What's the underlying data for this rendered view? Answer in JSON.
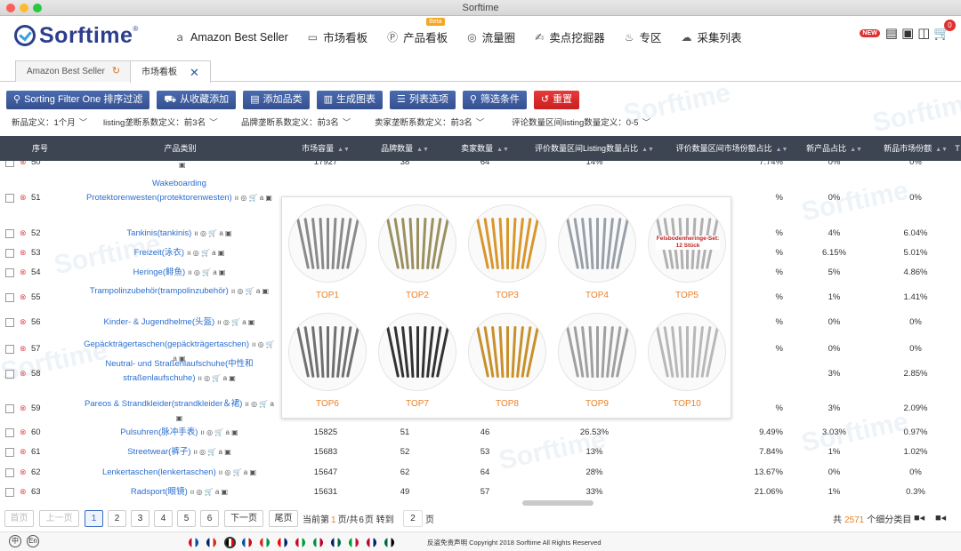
{
  "window": {
    "title": "Sorftime"
  },
  "brand": {
    "name": "Sorftime",
    "registered": "®"
  },
  "nav": [
    {
      "icon": "amazon-icon",
      "label": "Amazon Best Seller"
    },
    {
      "icon": "market-board-icon",
      "label": "市场看板"
    },
    {
      "icon": "product-board-icon",
      "label": "产品看板",
      "badge": "Beta"
    },
    {
      "icon": "traffic-circle-icon",
      "label": "流量圈"
    },
    {
      "icon": "selling-point-icon",
      "label": "卖点挖掘器"
    },
    {
      "icon": "lightbulb-icon",
      "label": "专区"
    },
    {
      "icon": "cloud-icon",
      "label": "采集列表"
    }
  ],
  "header_right": {
    "new_badge": "NEW",
    "cart_count": "0"
  },
  "tabs": [
    {
      "label": "Amazon Best Seller",
      "active": false
    },
    {
      "label": "市场看板",
      "active": true
    }
  ],
  "toolbar": {
    "sorting": "Sorting Filter One 排序过滤",
    "favorite": "从收藏添加",
    "add_category": "添加品类",
    "chart": "生成图表",
    "list_options": "列表选项",
    "filter": "筛选条件",
    "reset": "重置"
  },
  "filters": [
    "新品定义：1个月",
    "listing垄断系数定义：前3名",
    "品牌垄断系数定义：前3名",
    "卖家垄断系数定义：前3名",
    "评论数量区间listing数量定义：0-5"
  ],
  "columns": [
    "序号",
    "产品类别",
    "市场容量",
    "品牌数量",
    "卖家数量",
    "评价数量区间Listing数量占比",
    "评价数量区间市场份额占比",
    "新产品占比",
    "新品市场份额",
    "T"
  ],
  "rows": [
    {
      "id": "50",
      "category": "",
      "capacity": "17927",
      "brands": "38",
      "sellers": "64",
      "listing_ratio": "14%",
      "market_ratio": "7.74%",
      "new_ratio": "0%",
      "new_share": "0%"
    },
    {
      "id": "51",
      "category": "Wakeboarding Protektorenwesten(protektorenwesten)",
      "capacity": "",
      "brands": "",
      "sellers": "",
      "listing_ratio": "",
      "market_ratio": "%",
      "new_ratio": "0%",
      "new_share": "0%"
    },
    {
      "id": "52",
      "category": "Tankinis(tankinis)",
      "capacity": "",
      "brands": "",
      "sellers": "",
      "listing_ratio": "",
      "market_ratio": "%",
      "new_ratio": "4%",
      "new_share": "6.04%"
    },
    {
      "id": "53",
      "category": "Freizeit(泳衣)",
      "capacity": "",
      "brands": "",
      "sellers": "",
      "listing_ratio": "",
      "market_ratio": "%",
      "new_ratio": "6.15%",
      "new_share": "5.01%"
    },
    {
      "id": "54",
      "category": "Heringe(鲱鱼)",
      "capacity": "",
      "brands": "",
      "sellers": "",
      "listing_ratio": "",
      "market_ratio": "%",
      "new_ratio": "5%",
      "new_share": "4.86%"
    },
    {
      "id": "55",
      "category": "Trampolinzubehör(trampolinzubehör)",
      "capacity": "",
      "brands": "",
      "sellers": "",
      "listing_ratio": "",
      "market_ratio": "%",
      "new_ratio": "1%",
      "new_share": "1.41%"
    },
    {
      "id": "56",
      "category": "Kinder- & Jugendhelme(头盔)",
      "capacity": "",
      "brands": "",
      "sellers": "",
      "listing_ratio": "",
      "market_ratio": "%",
      "new_ratio": "0%",
      "new_share": "0%"
    },
    {
      "id": "57",
      "category": "Gepäckträgertaschen(gepäckträgertaschen)",
      "capacity": "",
      "brands": "",
      "sellers": "",
      "listing_ratio": "",
      "market_ratio": "%",
      "new_ratio": "0%",
      "new_share": "0%"
    },
    {
      "id": "58",
      "category": "Neutral- und Straßenlaufschuhe(中性和straßenlaufschuhe)",
      "capacity": "",
      "brands": "",
      "sellers": "",
      "listing_ratio": "",
      "market_ratio": "",
      "new_ratio": "3%",
      "new_share": "2.85%"
    },
    {
      "id": "59",
      "category": "Pareos & Strandkleider(strandkleider＆裙)",
      "capacity": "",
      "brands": "",
      "sellers": "",
      "listing_ratio": "",
      "market_ratio": "%",
      "new_ratio": "3%",
      "new_share": "2.09%"
    },
    {
      "id": "60",
      "category": "Pulsuhren(脉冲手表)",
      "capacity": "15825",
      "brands": "51",
      "sellers": "46",
      "listing_ratio": "26.53%",
      "market_ratio": "9.49%",
      "new_ratio": "3.03%",
      "new_share": "0.97%"
    },
    {
      "id": "61",
      "category": "Streetwear(裤子)",
      "capacity": "15683",
      "brands": "52",
      "sellers": "53",
      "listing_ratio": "13%",
      "market_ratio": "7.84%",
      "new_ratio": "1%",
      "new_share": "1.02%"
    },
    {
      "id": "62",
      "category": "Lenkertaschen(lenkertaschen)",
      "capacity": "15647",
      "brands": "62",
      "sellers": "64",
      "listing_ratio": "28%",
      "market_ratio": "13.67%",
      "new_ratio": "0%",
      "new_share": "0%"
    },
    {
      "id": "63",
      "category": "Radsport(眼镜)",
      "capacity": "15631",
      "brands": "49",
      "sellers": "57",
      "listing_ratio": "33%",
      "market_ratio": "21.06%",
      "new_ratio": "1%",
      "new_share": "0.3%"
    }
  ],
  "popup": {
    "items": [
      {
        "label": "TOP1"
      },
      {
        "label": "TOP2"
      },
      {
        "label": "TOP3"
      },
      {
        "label": "TOP4"
      },
      {
        "label": "TOP5",
        "image_text": "Felsbodenheringe-Set: 12 Stück"
      },
      {
        "label": "TOP6"
      },
      {
        "label": "TOP7"
      },
      {
        "label": "TOP8"
      },
      {
        "label": "TOP9"
      },
      {
        "label": "TOP10"
      }
    ]
  },
  "pager": {
    "first": "首页",
    "prev": "上一页",
    "pages": [
      "1",
      "2",
      "3",
      "4",
      "5",
      "6"
    ],
    "current": "1",
    "next": "下一页",
    "last": "尾页",
    "info_prefix": "当前第",
    "info_current": "1",
    "info_mid": "页/共",
    "info_total": "6",
    "info_suffix": "页 转到",
    "goto_value": "2",
    "goto_unit": "页",
    "total_prefix": "共",
    "total_count": "2571",
    "total_suffix": "个细分类目"
  },
  "footer": {
    "lang_cn": "中",
    "lang_en": "En",
    "disclaimer": "反盗免责声明",
    "copyright": "Copyright 2018 Sorftime All Rights Reserved"
  },
  "watermark": "Sorftime"
}
